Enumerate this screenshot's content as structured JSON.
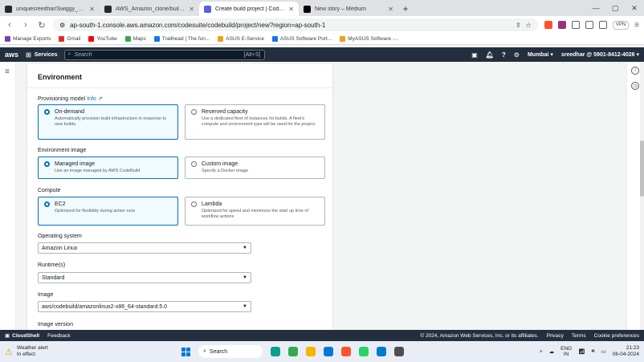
{
  "browser": {
    "tabs": [
      {
        "label": "uniquesreedhar/Swiggy_clone",
        "active": false,
        "favicon_color": "#24292f"
      },
      {
        "label": "AWS_Amazon_clone/buildspec.yaml",
        "active": false,
        "favicon_color": "#24292f"
      },
      {
        "label": "Create build project | CodeBuild",
        "active": true,
        "favicon_color": "#5a5ee0"
      },
      {
        "label": "New story – Medium",
        "active": false,
        "favicon_color": "#000000"
      }
    ],
    "url": "ap-south-1.console.aws.amazon.com/codesuite/codebuild/project/new?region=ap-south-1",
    "vpn_label": "VPN",
    "bookmarks": [
      {
        "label": "Manage Exports",
        "color": "#7b3fb5"
      },
      {
        "label": "Gmail",
        "color": "#d93025"
      },
      {
        "label": "YouTube",
        "color": "#ff0000"
      },
      {
        "label": "Maps",
        "color": "#34a853"
      },
      {
        "label": "Trailhead | The fun...",
        "color": "#1a73e8"
      },
      {
        "label": "ASUS E-Service",
        "color": "#e8a317"
      },
      {
        "label": "ASUS Software Port...",
        "color": "#1a73e8"
      },
      {
        "label": "MyASUS Software -...",
        "color": "#e8a317"
      }
    ]
  },
  "aws_nav": {
    "logo": "aws",
    "services_label": "Services",
    "search_placeholder": "Search",
    "search_shortcut": "[Alt+S]",
    "region": "Mumbai ▾",
    "account": "sreedhar @ 5901-8412-4026 ▾"
  },
  "environment": {
    "heading": "Environment",
    "provisioning": {
      "label": "Provisioning model",
      "info": "Info",
      "options": [
        {
          "title": "On-demand",
          "desc": "Automatically provision build infrastructure in response to new builds.",
          "selected": true
        },
        {
          "title": "Reserved capacity",
          "desc": "Use a dedicated fleet of instances for builds. A fleet's compute and environment type will be used for the project.",
          "selected": false
        }
      ]
    },
    "env_image": {
      "label": "Environment image",
      "options": [
        {
          "title": "Managed image",
          "desc": "Use an image managed by AWS CodeBuild",
          "selected": true
        },
        {
          "title": "Custom image",
          "desc": "Specify a Docker image",
          "selected": false
        }
      ]
    },
    "compute": {
      "label": "Compute",
      "options": [
        {
          "title": "EC2",
          "desc": "Optimized for flexibility during action runs",
          "selected": true
        },
        {
          "title": "Lambda",
          "desc": "Optimized for speed and minimizes the start up time of workflow actions",
          "selected": false
        }
      ]
    },
    "os": {
      "label": "Operating system",
      "value": "Amazon Linux"
    },
    "runtime": {
      "label": "Runtime(s)",
      "value": "Standard"
    },
    "image": {
      "label": "Image",
      "value": "aws/codebuild/amazonlinux2-x86_64-standard:5.0"
    },
    "image_version": {
      "label": "Image version"
    }
  },
  "footer": {
    "cloudshell": "CloudShell",
    "feedback": "Feedback",
    "copyright": "© 2024, Amazon Web Services, Inc. or its affiliates.",
    "privacy": "Privacy",
    "terms": "Terms",
    "cookies": "Cookie preferences"
  },
  "taskbar": {
    "weather_title": "Weather alert",
    "weather_sub": "In effect",
    "search": "Search",
    "lang1": "ENG",
    "lang2": "IN",
    "time": "21:23",
    "date": "06-04-2024",
    "apps": [
      {
        "name": "edge-icon",
        "color": "#0f9d8c"
      },
      {
        "name": "chrome-icon",
        "color": "#34a853"
      },
      {
        "name": "file-explorer-icon",
        "color": "#f4b400"
      },
      {
        "name": "store-icon",
        "color": "#0078d4"
      },
      {
        "name": "brave-icon",
        "color": "#fb542b"
      },
      {
        "name": "whatsapp-icon",
        "color": "#25d366"
      },
      {
        "name": "vscode-icon",
        "color": "#007acc"
      },
      {
        "name": "git-icon",
        "color": "#4e4e4e"
      }
    ]
  }
}
